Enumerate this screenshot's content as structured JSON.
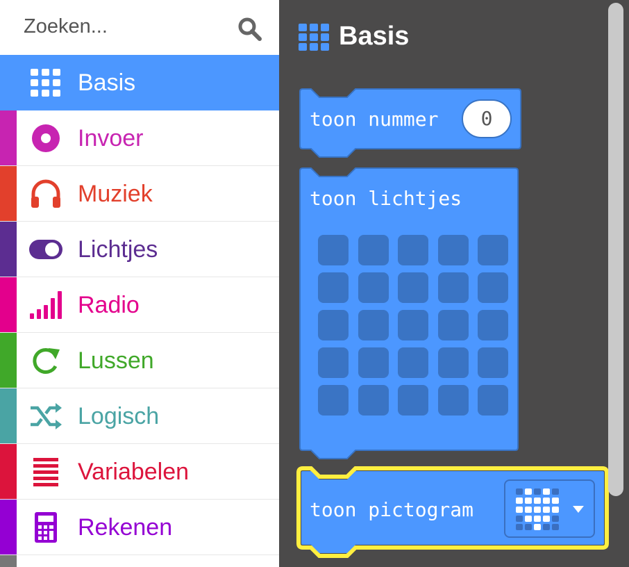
{
  "search": {
    "placeholder": "Zoeken..."
  },
  "categories": [
    {
      "label": "Basis",
      "color": "#4c97ff",
      "icon": "grid-icon",
      "selected": true
    },
    {
      "label": "Invoer",
      "color": "#c724b1",
      "icon": "target-icon"
    },
    {
      "label": "Muziek",
      "color": "#e2402c",
      "icon": "headphones-icon"
    },
    {
      "label": "Lichtjes",
      "color": "#5c2d91",
      "icon": "toggle-icon"
    },
    {
      "label": "Radio",
      "color": "#e3008c",
      "icon": "signal-bars-icon"
    },
    {
      "label": "Lussen",
      "color": "#40a829",
      "icon": "refresh-icon"
    },
    {
      "label": "Logisch",
      "color": "#4aa4a4",
      "icon": "shuffle-icon"
    },
    {
      "label": "Variabelen",
      "color": "#dc143c",
      "icon": "list-lines-icon"
    },
    {
      "label": "Rekenen",
      "color": "#9400d3",
      "icon": "calculator-icon"
    }
  ],
  "flyout": {
    "title": "Basis",
    "blocks": [
      {
        "text": "toon nummer",
        "value": "0"
      },
      {
        "text": "toon lichtjes"
      },
      {
        "text": "toon pictogram"
      }
    ]
  },
  "colors": {
    "block": "#4c97ff",
    "flyout_bg": "#4b4a4a",
    "highlight": "#ffef40"
  }
}
